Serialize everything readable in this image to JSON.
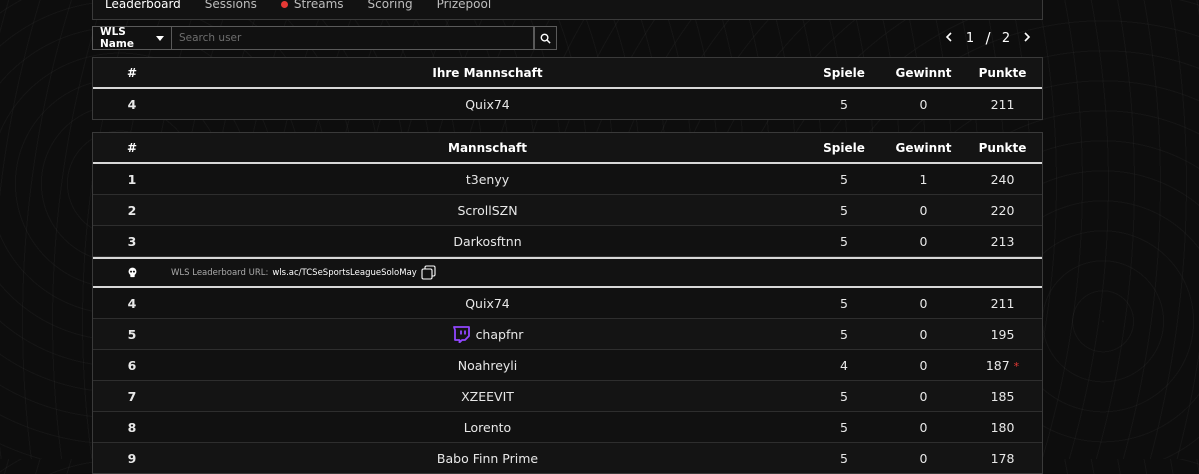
{
  "tabs": [
    {
      "label": "Leaderboard",
      "active": true,
      "live": false
    },
    {
      "label": "Sessions",
      "active": false,
      "live": false
    },
    {
      "label": "Streams",
      "active": false,
      "live": true
    },
    {
      "label": "Scoring",
      "active": false,
      "live": false
    },
    {
      "label": "Prizepool",
      "active": false,
      "live": false
    }
  ],
  "filter": {
    "select_label": "WLS Name",
    "search_placeholder": "Search user"
  },
  "pagination": {
    "current": "1",
    "separator": "/",
    "total": "2"
  },
  "my_team_table": {
    "headers": {
      "rank": "#",
      "team": "Ihre Mannschaft",
      "games": "Spiele",
      "wins": "Gewinnt",
      "points": "Punkte"
    },
    "rows": [
      {
        "rank": "4",
        "team": "Quix74",
        "games": "5",
        "wins": "0",
        "points": "211"
      }
    ]
  },
  "leaderboard_table": {
    "headers": {
      "rank": "#",
      "team": "Mannschaft",
      "games": "Spiele",
      "wins": "Gewinnt",
      "points": "Punkte"
    },
    "top_rows": [
      {
        "rank": "1",
        "team": "t3enyy",
        "games": "5",
        "wins": "1",
        "points": "240"
      },
      {
        "rank": "2",
        "team": "ScrollSZN",
        "games": "5",
        "wins": "0",
        "points": "220"
      },
      {
        "rank": "3",
        "team": "Darkosftnn",
        "games": "5",
        "wins": "0",
        "points": "213"
      }
    ],
    "url_banner": {
      "label": "WLS Leaderboard URL:",
      "url": "wls.ac/TCSeSportsLeagueSoloMay"
    },
    "rows": [
      {
        "rank": "4",
        "team": "Quix74",
        "games": "5",
        "wins": "0",
        "points": "211",
        "twitch": false,
        "flag": ""
      },
      {
        "rank": "5",
        "team": "chapfnr",
        "games": "5",
        "wins": "0",
        "points": "195",
        "twitch": true,
        "flag": ""
      },
      {
        "rank": "6",
        "team": "Noahreyli",
        "games": "4",
        "wins": "0",
        "points": "187",
        "twitch": false,
        "flag": "*"
      },
      {
        "rank": "7",
        "team": "XZEEVIT",
        "games": "5",
        "wins": "0",
        "points": "185",
        "twitch": false,
        "flag": ""
      },
      {
        "rank": "8",
        "team": "Lorento",
        "games": "5",
        "wins": "0",
        "points": "180",
        "twitch": false,
        "flag": ""
      },
      {
        "rank": "9",
        "team": "Babo Finn Prime",
        "games": "5",
        "wins": "0",
        "points": "178",
        "twitch": false,
        "flag": ""
      }
    ]
  },
  "colors": {
    "accent_live": "#e53935",
    "twitch": "#9146ff"
  }
}
